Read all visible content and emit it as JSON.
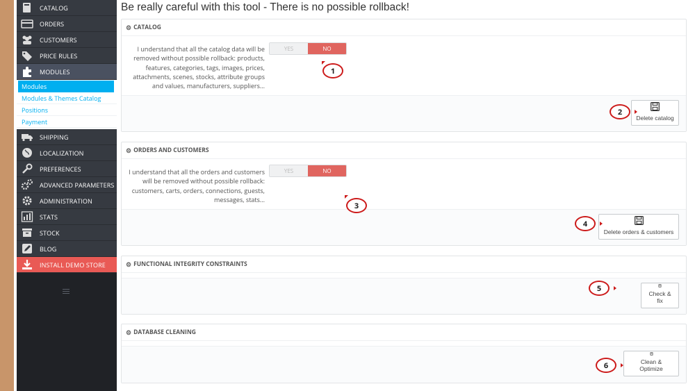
{
  "sidebar": {
    "items_top": [
      {
        "label": "CATALOG",
        "icon": "catalog-icon"
      },
      {
        "label": "ORDERS",
        "icon": "orders-icon"
      },
      {
        "label": "CUSTOMERS",
        "icon": "customers-icon"
      },
      {
        "label": "PRICE RULES",
        "icon": "price-rules-icon"
      },
      {
        "label": "MODULES",
        "icon": "modules-icon"
      }
    ],
    "submenu": [
      "Modules",
      "Modules & Themes Catalog",
      "Positions",
      "Payment"
    ],
    "items_bottom": [
      {
        "label": "SHIPPING",
        "icon": "shipping-icon"
      },
      {
        "label": "LOCALIZATION",
        "icon": "localization-icon"
      },
      {
        "label": "PREFERENCES",
        "icon": "preferences-icon"
      },
      {
        "label": "ADVANCED PARAMETERS",
        "icon": "advanced-parameters-icon"
      },
      {
        "label": "ADMINISTRATION",
        "icon": "administration-icon"
      },
      {
        "label": "STATS",
        "icon": "stats-icon"
      },
      {
        "label": "STOCK",
        "icon": "stock-icon"
      },
      {
        "label": "BLOG",
        "icon": "blog-icon"
      },
      {
        "label": "INSTALL DEMO STORE",
        "icon": "install-icon"
      }
    ]
  },
  "page": {
    "title": "Be really careful with this tool - There is no possible rollback!"
  },
  "panels": {
    "catalog": {
      "title": "CATALOG",
      "description": "I understand that all the catalog data will be removed without possible rollback: products, features, categories, tags, images, prices, attachments, scenes, stocks, attribute groups and values, manufacturers, suppliers...",
      "toggle": {
        "yes": "YES",
        "no": "NO",
        "selected": "no"
      },
      "button": "Delete catalog"
    },
    "orders": {
      "title": "ORDERS AND CUSTOMERS",
      "description": "I understand that all the orders and customers will be removed without possible rollback: customers, carts, orders, connections, guests, messages, stats...",
      "toggle": {
        "yes": "YES",
        "no": "NO",
        "selected": "no"
      },
      "button": "Delete orders & customers"
    },
    "integrity": {
      "title": "FUNCTIONAL INTEGRITY CONSTRAINTS",
      "button": "Check & fix"
    },
    "cleaning": {
      "title": "DATABASE CLEANING",
      "button": "Clean & Optimize"
    }
  },
  "markers": [
    "1",
    "2",
    "3",
    "4",
    "5",
    "6"
  ],
  "colors": {
    "accent": "#00aff0",
    "danger": "#e0655f",
    "sidebar": "#363a41",
    "marker": "#cc1a1a"
  }
}
